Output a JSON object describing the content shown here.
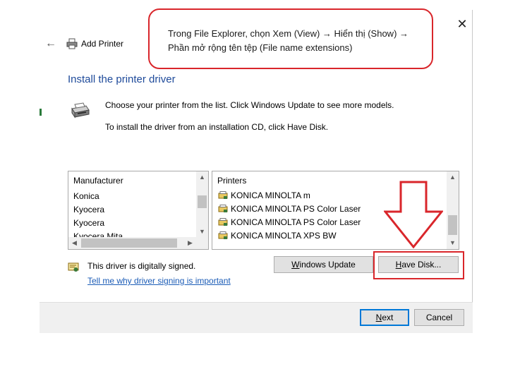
{
  "window": {
    "title": "Add Printer",
    "close_glyph": "✕",
    "back_glyph": "←",
    "printer_icon": "printer-icon"
  },
  "page": {
    "heading": "Install the printer driver",
    "description_line1": "Choose your printer from the list. Click Windows Update to see more models.",
    "description_line2": "To install the driver from an installation CD, click Have Disk."
  },
  "manufacturer_list": {
    "header": "Manufacturer",
    "items": [
      "Konica",
      "Kyocera",
      "Kyocera",
      "Kyocera Mita"
    ]
  },
  "printers_list": {
    "header": "Printers",
    "items": [
      "KONICA MINOLTA m",
      "KONICA MINOLTA PS Color Laser",
      "KONICA MINOLTA PS Color Laser",
      "KONICA MINOLTA XPS BW"
    ]
  },
  "scroll_glyphs": {
    "up": "▲",
    "down": "▼",
    "left": "◀",
    "right": "▶"
  },
  "signing": {
    "status": "This driver is digitally signed.",
    "link": "Tell me why driver signing is important"
  },
  "buttons": {
    "windows_update": {
      "mnemonic": "W",
      "rest": "indows Update"
    },
    "have_disk": {
      "mnemonic": "H",
      "rest": "ave Disk..."
    },
    "next": {
      "mnemonic": "N",
      "rest": "ext"
    },
    "cancel": "Cancel"
  },
  "annotation": {
    "line1": "Trong File Explorer, chọn Xem (View) → Hiển thị (Show) →",
    "line2": "Phần mở rộng tên tệp (File name extensions)"
  },
  "colors": {
    "heading": "#1e4a9a",
    "link": "#1a5bb6",
    "annotation_red": "#d9262b",
    "next_border": "#0078d7"
  }
}
